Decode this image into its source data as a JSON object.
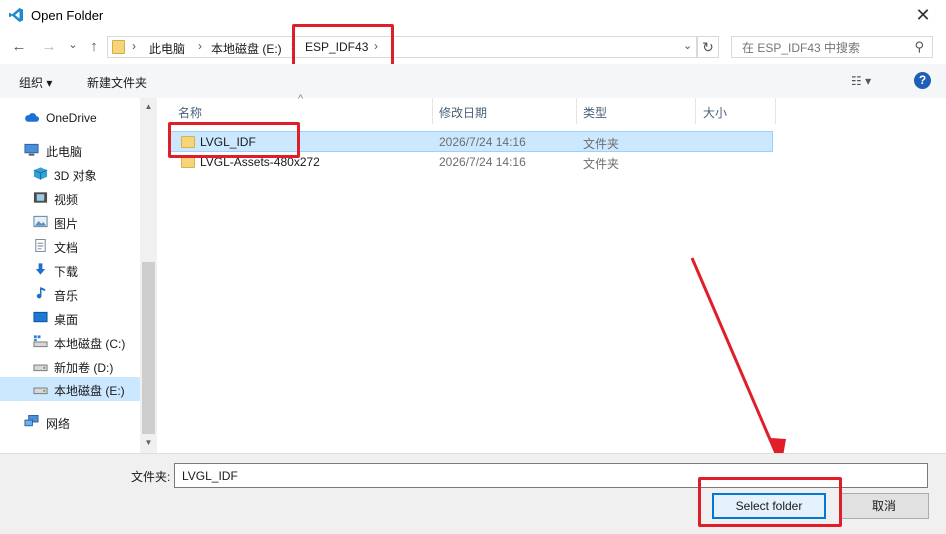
{
  "window": {
    "title": "Open Folder",
    "close_label": "✕"
  },
  "nav_buttons": {
    "back": "←",
    "forward": "→",
    "recent": "⌄",
    "up": "↑"
  },
  "address": {
    "crumbs": [
      "此电脑",
      "本地磁盘 (E:)",
      "ESP_IDF43"
    ],
    "separator": "›",
    "dropdown": "⌄",
    "refresh": "↻"
  },
  "search": {
    "placeholder": "在 ESP_IDF43 中搜索",
    "icon": "⚲"
  },
  "toolbar": {
    "organize_label": "组织 ▾",
    "new_folder_label": "新建文件夹",
    "view_label": "☷ ▾",
    "help_label": "?"
  },
  "sidebar": {
    "items": [
      {
        "label": "OneDrive",
        "icon": "cloud-icon"
      },
      {
        "label": "此电脑",
        "icon": "computer-icon"
      },
      {
        "label": "3D 对象",
        "icon": "cube-icon"
      },
      {
        "label": "视频",
        "icon": "video-icon"
      },
      {
        "label": "图片",
        "icon": "picture-icon"
      },
      {
        "label": "文档",
        "icon": "document-icon"
      },
      {
        "label": "下载",
        "icon": "download-icon"
      },
      {
        "label": "音乐",
        "icon": "music-icon"
      },
      {
        "label": "桌面",
        "icon": "desktop-icon"
      },
      {
        "label": "本地磁盘 (C:)",
        "icon": "drive-icon"
      },
      {
        "label": "新加卷 (D:)",
        "icon": "drive-icon"
      },
      {
        "label": "本地磁盘 (E:)",
        "icon": "drive-icon",
        "selected": true
      },
      {
        "label": "网络",
        "icon": "network-icon"
      }
    ]
  },
  "columns": {
    "name": "名称",
    "date": "修改日期",
    "type": "类型",
    "size": "大小",
    "sort_indicator": "^"
  },
  "files": [
    {
      "name": "LVGL_IDF",
      "date": "2026/7/24 14:16",
      "type": "文件夹",
      "selected": true
    },
    {
      "name": "LVGL-Assets-480x272",
      "date": "2026/7/24 14:16",
      "type": "文件夹"
    }
  ],
  "footer": {
    "folder_label": "文件夹:",
    "folder_value": "LVGL_IDF",
    "select_button": "Select folder",
    "cancel_button": "取消"
  },
  "colors": {
    "annotation": "#e01e2a",
    "accent": "#0078d7",
    "selection": "#cce8ff"
  }
}
